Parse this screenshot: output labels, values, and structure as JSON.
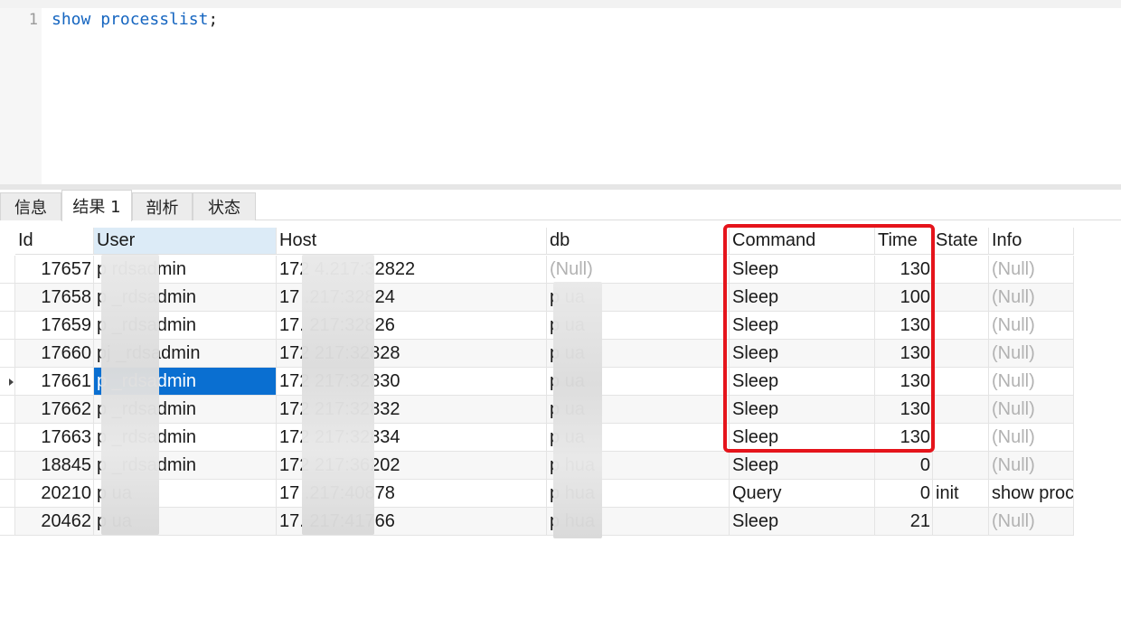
{
  "editor": {
    "line_number": "1",
    "keyword1": "show",
    "keyword2": "processlist",
    "terminator": ";"
  },
  "tabs": [
    {
      "label": "信息",
      "active": false
    },
    {
      "label": "结果 1",
      "active": true
    },
    {
      "label": "剖析",
      "active": false
    },
    {
      "label": "状态",
      "active": false
    }
  ],
  "grid": {
    "columns": [
      "Id",
      "User",
      "Host",
      "db",
      "Command",
      "Time",
      "State",
      "Info"
    ],
    "rows": [
      {
        "id": "17657",
        "user": "p        rdsadmin",
        "host": "172        4.217:32822",
        "db": "(Null)",
        "command": "Sleep",
        "time": "130",
        "state": "",
        "info": "(Null)"
      },
      {
        "id": "17658",
        "user": "p        _rdsadmin",
        "host": "17        .217:32824",
        "db": "p        ua",
        "command": "Sleep",
        "time": "100",
        "state": "",
        "info": "(Null)"
      },
      {
        "id": "17659",
        "user": "p        _rdsadmin",
        "host": "17.        217:32826",
        "db": "p        ua",
        "command": "Sleep",
        "time": "130",
        "state": "",
        "info": "(Null)"
      },
      {
        "id": "17660",
        "user": "pj        _rdsadmin",
        "host": "172        217:32828",
        "db": "p        ua",
        "command": "Sleep",
        "time": "130",
        "state": "",
        "info": "(Null)"
      },
      {
        "id": "17661",
        "user": "p        _rdsadmin",
        "host": "172        217:32830",
        "db": "p        ua",
        "command": "Sleep",
        "time": "130",
        "state": "",
        "info": "(Null)"
      },
      {
        "id": "17662",
        "user": "p        _rdsadmin",
        "host": "172        217:32832",
        "db": "p        ua",
        "command": "Sleep",
        "time": "130",
        "state": "",
        "info": "(Null)"
      },
      {
        "id": "17663",
        "user": "p        _rdsadmin",
        "host": "172        217:32834",
        "db": "p        ua",
        "command": "Sleep",
        "time": "130",
        "state": "",
        "info": "(Null)"
      },
      {
        "id": "18845",
        "user": "p        _rdsadmin",
        "host": "172        217:36202",
        "db": "p        hua",
        "command": "Sleep",
        "time": "0",
        "state": "",
        "info": "(Null)"
      },
      {
        "id": "20210",
        "user": "p        ua",
        "host": "17        .217:40878",
        "db": "p        hua",
        "command": "Query",
        "time": "0",
        "state": "init",
        "info": "show proc"
      },
      {
        "id": "20462",
        "user": "p        ua",
        "host": "17.        217:41766",
        "db": "p        hua",
        "command": "Sleep",
        "time": "21",
        "state": "",
        "info": "(Null)"
      }
    ],
    "selected_row_index": 4
  },
  "colors": {
    "keyword": "#1565c0",
    "selection": "#0a6fd1",
    "highlight_border": "#e5141b",
    "null_text": "#b2b2b2"
  }
}
